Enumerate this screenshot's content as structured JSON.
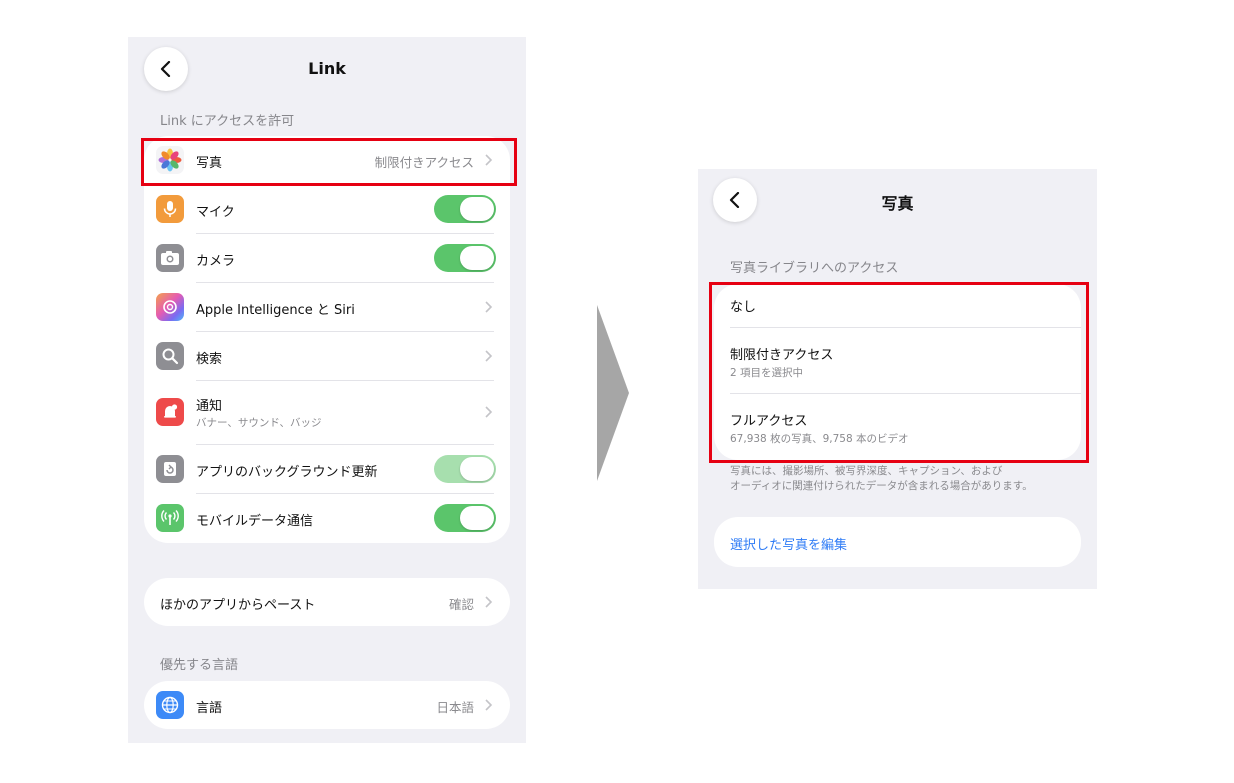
{
  "left": {
    "title": "Link",
    "section_header": "Link にアクセスを許可",
    "items": [
      {
        "label": "写真",
        "value": "制限付きアクセス"
      },
      {
        "label": "マイク"
      },
      {
        "label": "カメラ"
      },
      {
        "label": "Apple Intelligence と Siri"
      },
      {
        "label": "検索"
      },
      {
        "label": "通知",
        "sub": "バナー、サウンド、バッジ"
      },
      {
        "label": "アプリのバックグラウンド更新"
      },
      {
        "label": "モバイルデータ通信"
      }
    ],
    "toggles": {
      "mic": true,
      "camera": true,
      "background_refresh": true,
      "mobile_data": true
    },
    "paste": {
      "label": "ほかのアプリからペースト",
      "value": "確認"
    },
    "language_header": "優先する言語",
    "language": {
      "label": "言語",
      "value": "日本語"
    }
  },
  "right": {
    "title": "写真",
    "section_header": "写真ライブラリへのアクセス",
    "options": [
      {
        "label": "なし"
      },
      {
        "label": "制限付きアクセス",
        "sub": "2 項目を選択中"
      },
      {
        "label": "フルアクセス",
        "sub": "67,938 枚の写真、9,758 本のビデオ"
      }
    ],
    "footnote_line1": "写真には、撮影場所、被写界深度、キャプション、および",
    "footnote_line2": "オーディオに関連付けられたデータが含まれる場合があります。",
    "edit_link": "選択した写真を編集"
  },
  "colors": {
    "highlight": "#e60012",
    "toggle_on": "#5bc56b",
    "link": "#2f7cf6",
    "arrow": "#a6a6a6"
  },
  "icons": {
    "back": "chevron-left-icon",
    "photos": "photos-flower-icon",
    "mic": "microphone-icon",
    "camera": "camera-icon",
    "siri": "apple-intelligence-icon",
    "search": "magnifier-icon",
    "notifications": "notification-bell-icon",
    "refresh": "background-refresh-icon",
    "cellular": "antenna-icon",
    "language": "globe-icon",
    "flow": "right-triangle-arrow-icon"
  }
}
